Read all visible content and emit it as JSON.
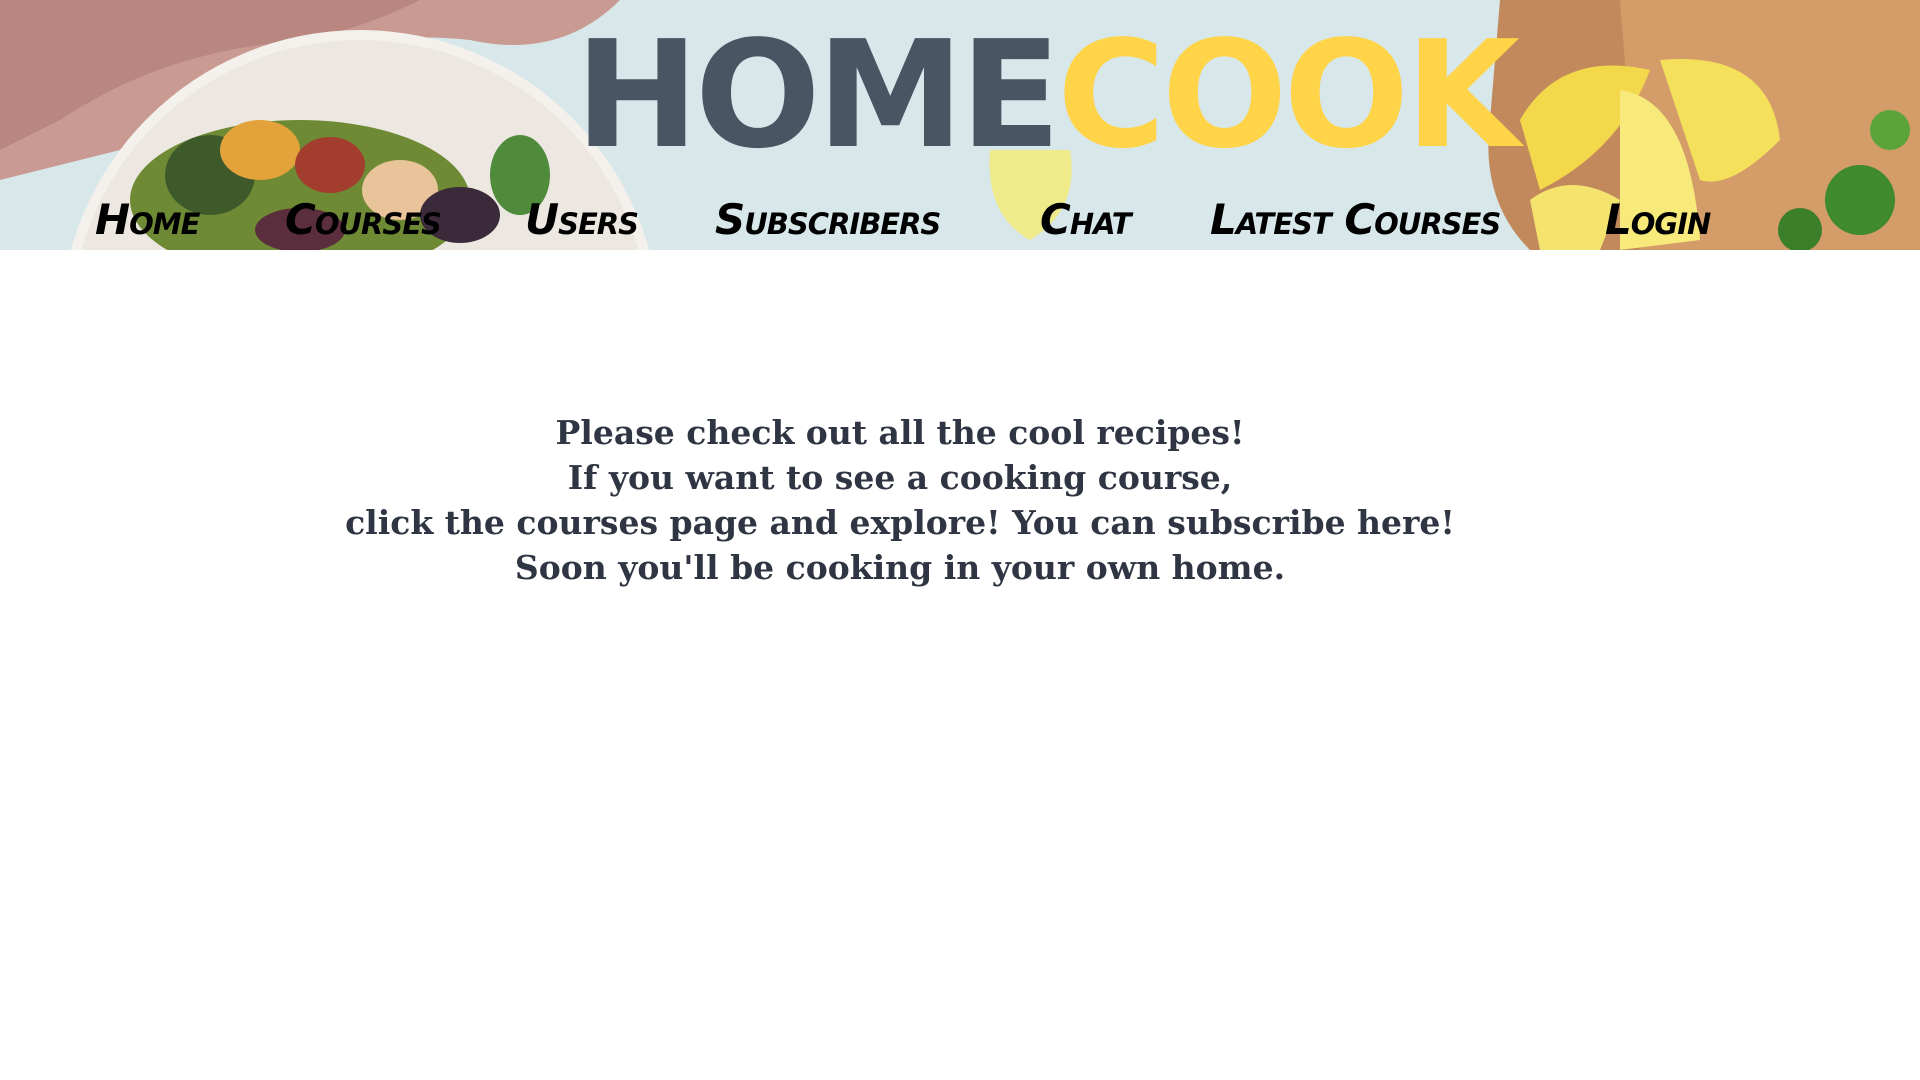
{
  "header": {
    "logo": {
      "part1": "HOME",
      "part2": "COOK",
      "part1_color": "#4a5563",
      "part2_color": "#ffd449"
    },
    "background": "food-photo-banner"
  },
  "nav": {
    "items": [
      {
        "label": "Home"
      },
      {
        "label": "Courses"
      },
      {
        "label": "Users"
      },
      {
        "label": "Subscribers"
      },
      {
        "label": "Chat"
      },
      {
        "label": "Latest Courses"
      },
      {
        "label": "Login"
      }
    ]
  },
  "main": {
    "lines": [
      "Please check out all the cool recipes!",
      "If you want to see a cooking course,",
      "click the courses page and explore! You can subscribe here!",
      "Soon you'll be cooking in your own home."
    ]
  }
}
